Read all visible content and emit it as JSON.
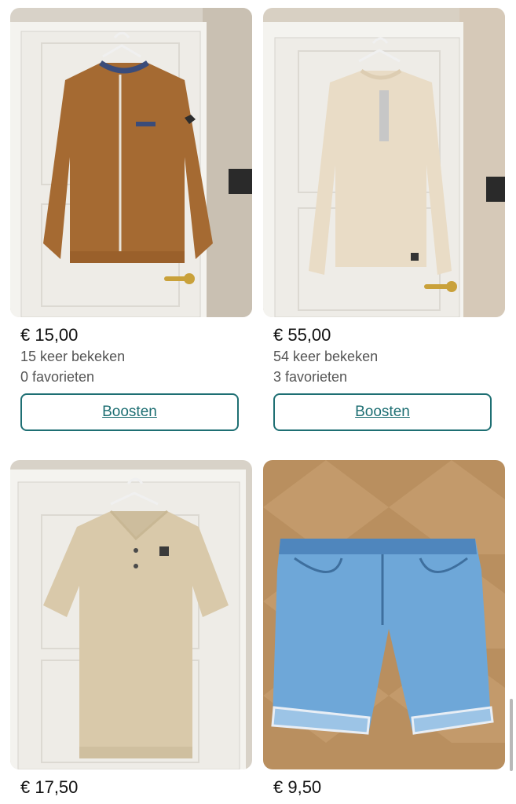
{
  "items": [
    {
      "price": "€ 15,00",
      "views": "15 keer bekeken",
      "favorites": "0 favorieten",
      "boost_label": "Boosten",
      "image_desc": "brown-zip-jacket"
    },
    {
      "price": "€ 55,00",
      "views": "54 keer bekeken",
      "favorites": "3 favorieten",
      "boost_label": "Boosten",
      "image_desc": "cream-sweater"
    },
    {
      "price": "€ 17,50",
      "image_desc": "beige-polo-shirt"
    },
    {
      "price": "€ 9,50",
      "image_desc": "denim-shorts"
    }
  ],
  "colors": {
    "accent": "#1e6f73"
  }
}
